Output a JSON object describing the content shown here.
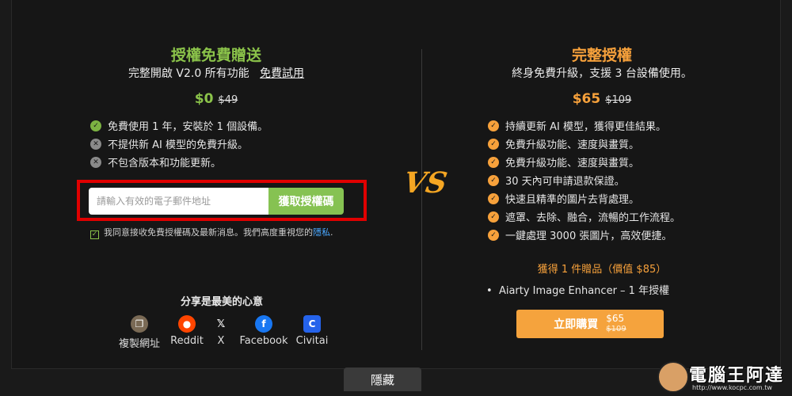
{
  "free": {
    "title": "授權免費贈送",
    "subtitle": "完整開啟 V2.0 所有功能",
    "trial_link": "免費試用",
    "price": "$0",
    "old_price": "$49",
    "features": [
      {
        "icon": "check-icon",
        "text": "免費使用 1 年，安裝於 1 個設備。"
      },
      {
        "icon": "cross-icon",
        "text": "不提供新 AI 模型的免費升級。"
      },
      {
        "icon": "cross-icon",
        "text": "不包含版本和功能更新。"
      }
    ],
    "email_placeholder": "請輸入有效的電子郵件地址",
    "get_button": "獲取授權碼",
    "agree_text": "我同意接收免費授權碼及最新消息。我們高度重視您的",
    "privacy_link": "隱私",
    "agree_end": ".",
    "share_title": "分享是最美的心意",
    "share": [
      {
        "icon": "copy-icon",
        "label": "複製網址",
        "color": "#7a6a55"
      },
      {
        "icon": "reddit-icon",
        "label": "Reddit",
        "color": "#ff4500"
      },
      {
        "icon": "x-icon",
        "label": "X",
        "color": "#161616"
      },
      {
        "icon": "facebook-icon",
        "label": "Facebook",
        "color": "#1877f2"
      },
      {
        "icon": "civitai-icon",
        "label": "Civitai",
        "color": "#2563eb"
      }
    ]
  },
  "vs": "VS",
  "full": {
    "title": "完整授權",
    "subtitle": "終身免費升級，支援 3 台設備使用。",
    "price": "$65",
    "old_price": "$109",
    "features": [
      "持續更新 AI 模型，獲得更佳結果。",
      "免費升級功能、速度與畫質。",
      "免費升級功能、速度與畫質。",
      "30 天內可申請退款保證。",
      "快速且精準的圖片去背處理。",
      "遮罩、去除、融合，流暢的工作流程。",
      "一鍵處理 3000 張圖片，高效便捷。"
    ],
    "gift_title": "獲得 1 件贈品（價值 $85）",
    "gift_item": "Aiarty Image Enhancer – 1 年授權",
    "buy_label": "立即購買",
    "buy_price": "$65",
    "buy_old_price": "$109"
  },
  "hide_tab": "隱藏",
  "watermark": {
    "text": "電腦王阿達",
    "url": "http://www.kocpc.com.tw"
  },
  "colors": {
    "green": "#8bc34a",
    "orange": "#f7a13b",
    "highlight": "#e00000"
  }
}
